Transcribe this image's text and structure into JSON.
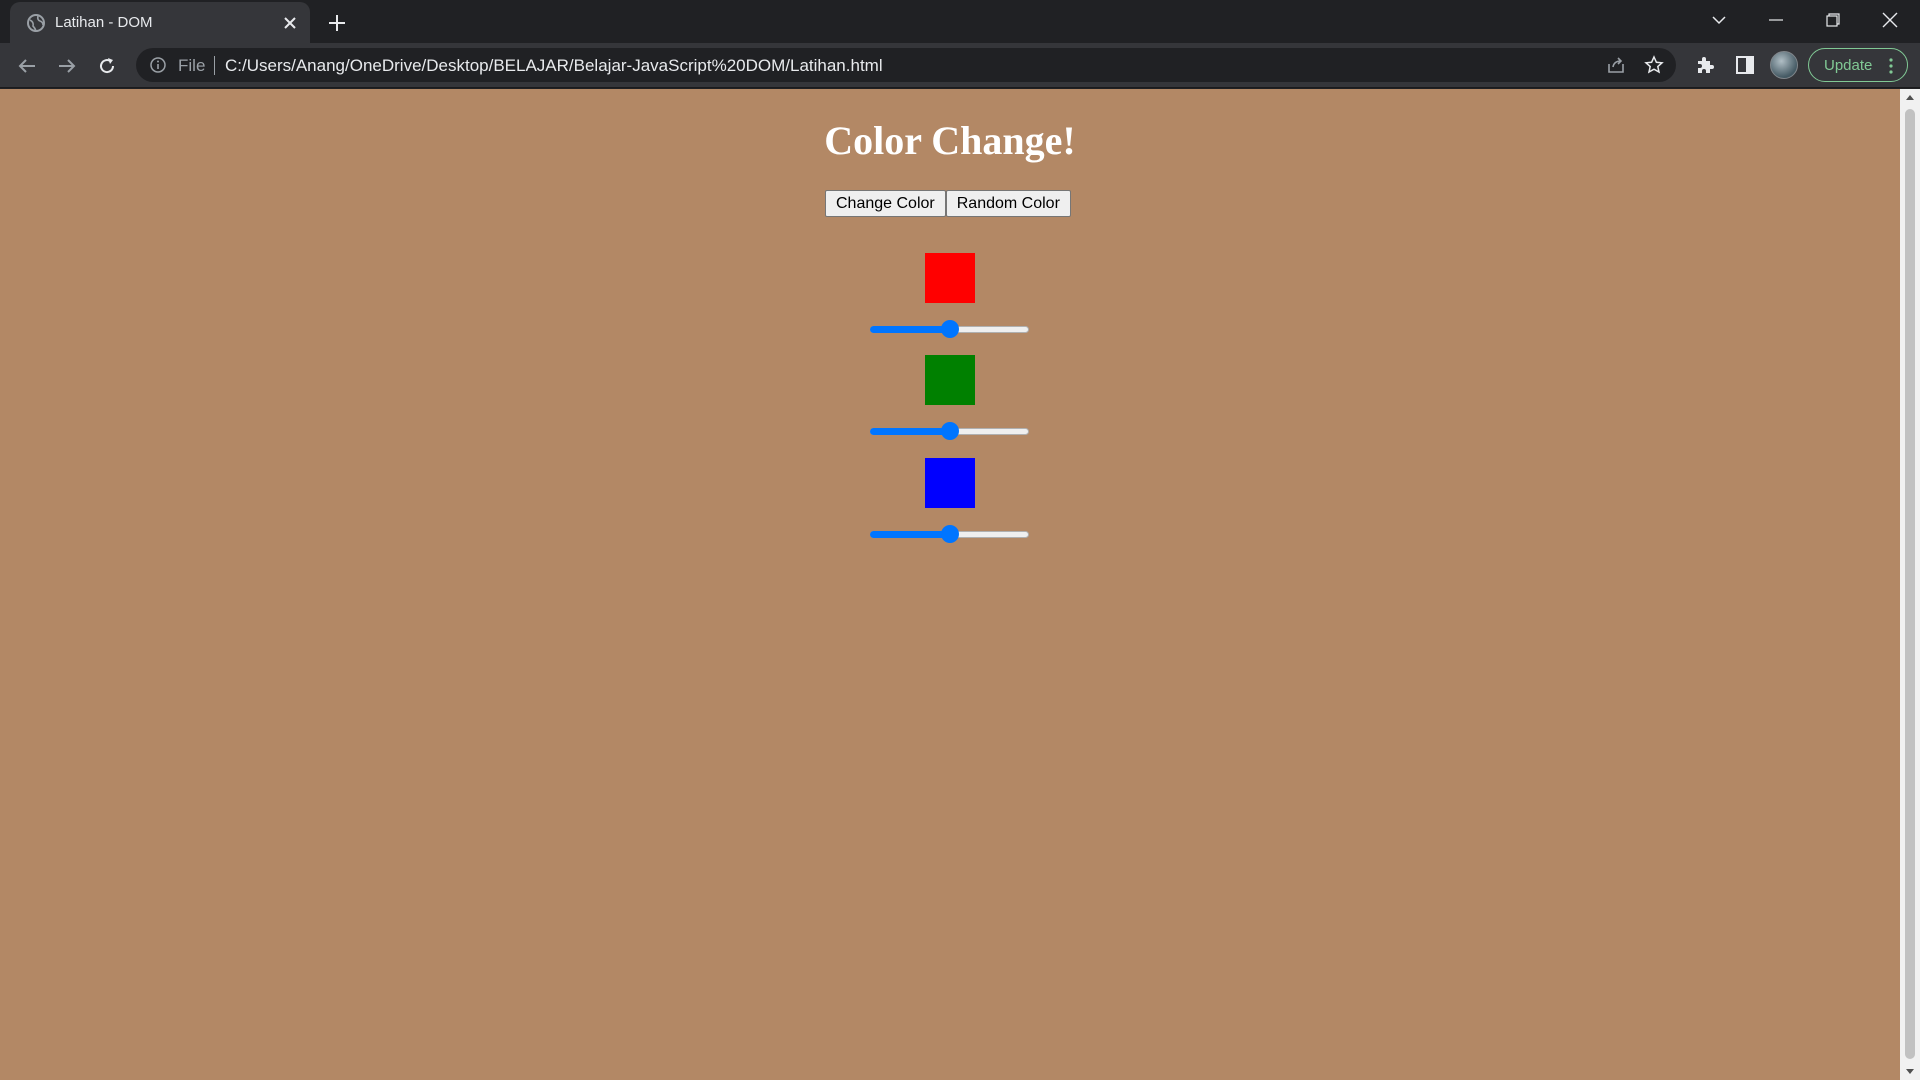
{
  "browser": {
    "tab_title": "Latihan - DOM",
    "url_scheme": "File",
    "url": "C:/Users/Anang/OneDrive/Desktop/BELAJAR/Belajar-JavaScript%20DOM/Latihan.html",
    "update_label": "Update"
  },
  "page": {
    "background_color": "#b38865",
    "heading": "Color Change!",
    "buttons": {
      "change_color": "Change Color",
      "random_color": "Random Color"
    },
    "swatches": [
      {
        "name": "red",
        "color": "#ff0000",
        "slider_fraction": 0.5
      },
      {
        "name": "green",
        "color": "#008000",
        "slider_fraction": 0.5
      },
      {
        "name": "blue",
        "color": "#0000ff",
        "slider_fraction": 0.5
      }
    ],
    "slider_accent_color": "#0075ff"
  }
}
